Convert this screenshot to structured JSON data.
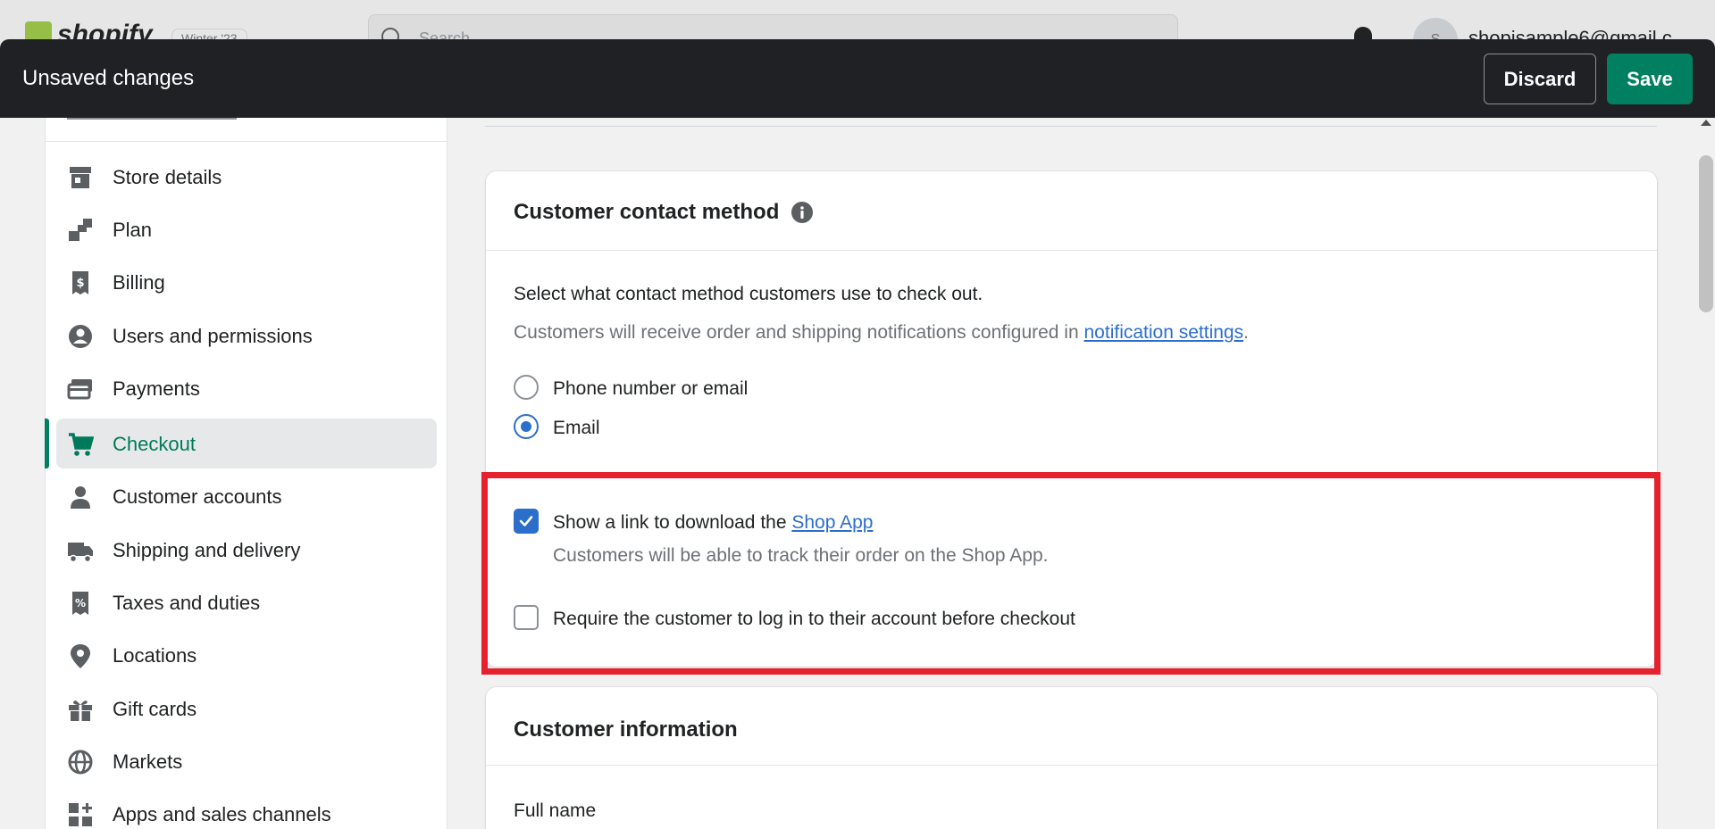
{
  "topbar": {
    "logo": "shopify",
    "version": "Winter '23",
    "search_placeholder": "Search",
    "avatar_initial": "S",
    "account_email": "shopisample6@gmail.c"
  },
  "savebar": {
    "title": "Unsaved changes",
    "discard_label": "Discard",
    "save_label": "Save"
  },
  "sidebar": {
    "items": [
      {
        "label": "Store details",
        "icon": "store-icon"
      },
      {
        "label": "Plan",
        "icon": "plan-icon"
      },
      {
        "label": "Billing",
        "icon": "billing-icon"
      },
      {
        "label": "Users and permissions",
        "icon": "user-circle-icon"
      },
      {
        "label": "Payments",
        "icon": "payments-icon"
      },
      {
        "label": "Checkout",
        "icon": "cart-icon",
        "active": true
      },
      {
        "label": "Customer accounts",
        "icon": "customer-icon"
      },
      {
        "label": "Shipping and delivery",
        "icon": "truck-icon"
      },
      {
        "label": "Taxes and duties",
        "icon": "tax-receipt-icon"
      },
      {
        "label": "Locations",
        "icon": "location-pin-icon"
      },
      {
        "label": "Gift cards",
        "icon": "gift-icon"
      },
      {
        "label": "Markets",
        "icon": "globe-icon"
      },
      {
        "label": "Apps and sales channels",
        "icon": "apps-icon"
      }
    ]
  },
  "contact_card": {
    "title": "Customer contact method",
    "description": "Select what contact method customers use to check out.",
    "notification_prefix": "Customers will receive order and shipping notifications configured in ",
    "notification_link": "notification settings",
    "notification_suffix": ".",
    "options": [
      {
        "label": "Phone number or email",
        "selected": false
      },
      {
        "label": "Email",
        "selected": true
      }
    ],
    "shop_app": {
      "label_prefix": "Show a link to download the ",
      "label_link": "Shop App",
      "checked": true,
      "help": "Customers will be able to track their order on the Shop App."
    },
    "require_login": {
      "label": "Require the customer to log in to their account before checkout",
      "checked": false
    }
  },
  "info_card": {
    "title": "Customer information",
    "field_label": "Full name"
  },
  "colors": {
    "accent": "#008060",
    "link": "#2c6ecb",
    "highlight": "#e4212c"
  }
}
